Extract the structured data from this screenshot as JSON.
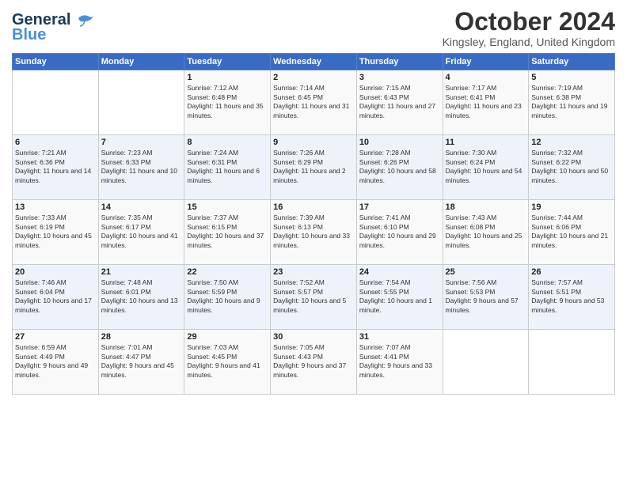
{
  "header": {
    "logo_general": "General",
    "logo_blue": "Blue",
    "month_title": "October 2024",
    "location": "Kingsley, England, United Kingdom"
  },
  "days_of_week": [
    "Sunday",
    "Monday",
    "Tuesday",
    "Wednesday",
    "Thursday",
    "Friday",
    "Saturday"
  ],
  "weeks": [
    [
      {
        "day": "",
        "info": ""
      },
      {
        "day": "",
        "info": ""
      },
      {
        "day": "1",
        "info": "Sunrise: 7:12 AM\nSunset: 6:48 PM\nDaylight: 11 hours and 35 minutes."
      },
      {
        "day": "2",
        "info": "Sunrise: 7:14 AM\nSunset: 6:45 PM\nDaylight: 11 hours and 31 minutes."
      },
      {
        "day": "3",
        "info": "Sunrise: 7:15 AM\nSunset: 6:43 PM\nDaylight: 11 hours and 27 minutes."
      },
      {
        "day": "4",
        "info": "Sunrise: 7:17 AM\nSunset: 6:41 PM\nDaylight: 11 hours and 23 minutes."
      },
      {
        "day": "5",
        "info": "Sunrise: 7:19 AM\nSunset: 6:38 PM\nDaylight: 11 hours and 19 minutes."
      }
    ],
    [
      {
        "day": "6",
        "info": "Sunrise: 7:21 AM\nSunset: 6:36 PM\nDaylight: 11 hours and 14 minutes."
      },
      {
        "day": "7",
        "info": "Sunrise: 7:23 AM\nSunset: 6:33 PM\nDaylight: 11 hours and 10 minutes."
      },
      {
        "day": "8",
        "info": "Sunrise: 7:24 AM\nSunset: 6:31 PM\nDaylight: 11 hours and 6 minutes."
      },
      {
        "day": "9",
        "info": "Sunrise: 7:26 AM\nSunset: 6:29 PM\nDaylight: 11 hours and 2 minutes."
      },
      {
        "day": "10",
        "info": "Sunrise: 7:28 AM\nSunset: 6:26 PM\nDaylight: 10 hours and 58 minutes."
      },
      {
        "day": "11",
        "info": "Sunrise: 7:30 AM\nSunset: 6:24 PM\nDaylight: 10 hours and 54 minutes."
      },
      {
        "day": "12",
        "info": "Sunrise: 7:32 AM\nSunset: 6:22 PM\nDaylight: 10 hours and 50 minutes."
      }
    ],
    [
      {
        "day": "13",
        "info": "Sunrise: 7:33 AM\nSunset: 6:19 PM\nDaylight: 10 hours and 45 minutes."
      },
      {
        "day": "14",
        "info": "Sunrise: 7:35 AM\nSunset: 6:17 PM\nDaylight: 10 hours and 41 minutes."
      },
      {
        "day": "15",
        "info": "Sunrise: 7:37 AM\nSunset: 6:15 PM\nDaylight: 10 hours and 37 minutes."
      },
      {
        "day": "16",
        "info": "Sunrise: 7:39 AM\nSunset: 6:13 PM\nDaylight: 10 hours and 33 minutes."
      },
      {
        "day": "17",
        "info": "Sunrise: 7:41 AM\nSunset: 6:10 PM\nDaylight: 10 hours and 29 minutes."
      },
      {
        "day": "18",
        "info": "Sunrise: 7:43 AM\nSunset: 6:08 PM\nDaylight: 10 hours and 25 minutes."
      },
      {
        "day": "19",
        "info": "Sunrise: 7:44 AM\nSunset: 6:06 PM\nDaylight: 10 hours and 21 minutes."
      }
    ],
    [
      {
        "day": "20",
        "info": "Sunrise: 7:46 AM\nSunset: 6:04 PM\nDaylight: 10 hours and 17 minutes."
      },
      {
        "day": "21",
        "info": "Sunrise: 7:48 AM\nSunset: 6:01 PM\nDaylight: 10 hours and 13 minutes."
      },
      {
        "day": "22",
        "info": "Sunrise: 7:50 AM\nSunset: 5:59 PM\nDaylight: 10 hours and 9 minutes."
      },
      {
        "day": "23",
        "info": "Sunrise: 7:52 AM\nSunset: 5:57 PM\nDaylight: 10 hours and 5 minutes."
      },
      {
        "day": "24",
        "info": "Sunrise: 7:54 AM\nSunset: 5:55 PM\nDaylight: 10 hours and 1 minute."
      },
      {
        "day": "25",
        "info": "Sunrise: 7:56 AM\nSunset: 5:53 PM\nDaylight: 9 hours and 57 minutes."
      },
      {
        "day": "26",
        "info": "Sunrise: 7:57 AM\nSunset: 5:51 PM\nDaylight: 9 hours and 53 minutes."
      }
    ],
    [
      {
        "day": "27",
        "info": "Sunrise: 6:59 AM\nSunset: 4:49 PM\nDaylight: 9 hours and 49 minutes."
      },
      {
        "day": "28",
        "info": "Sunrise: 7:01 AM\nSunset: 4:47 PM\nDaylight: 9 hours and 45 minutes."
      },
      {
        "day": "29",
        "info": "Sunrise: 7:03 AM\nSunset: 4:45 PM\nDaylight: 9 hours and 41 minutes."
      },
      {
        "day": "30",
        "info": "Sunrise: 7:05 AM\nSunset: 4:43 PM\nDaylight: 9 hours and 37 minutes."
      },
      {
        "day": "31",
        "info": "Sunrise: 7:07 AM\nSunset: 4:41 PM\nDaylight: 9 hours and 33 minutes."
      },
      {
        "day": "",
        "info": ""
      },
      {
        "day": "",
        "info": ""
      }
    ]
  ]
}
